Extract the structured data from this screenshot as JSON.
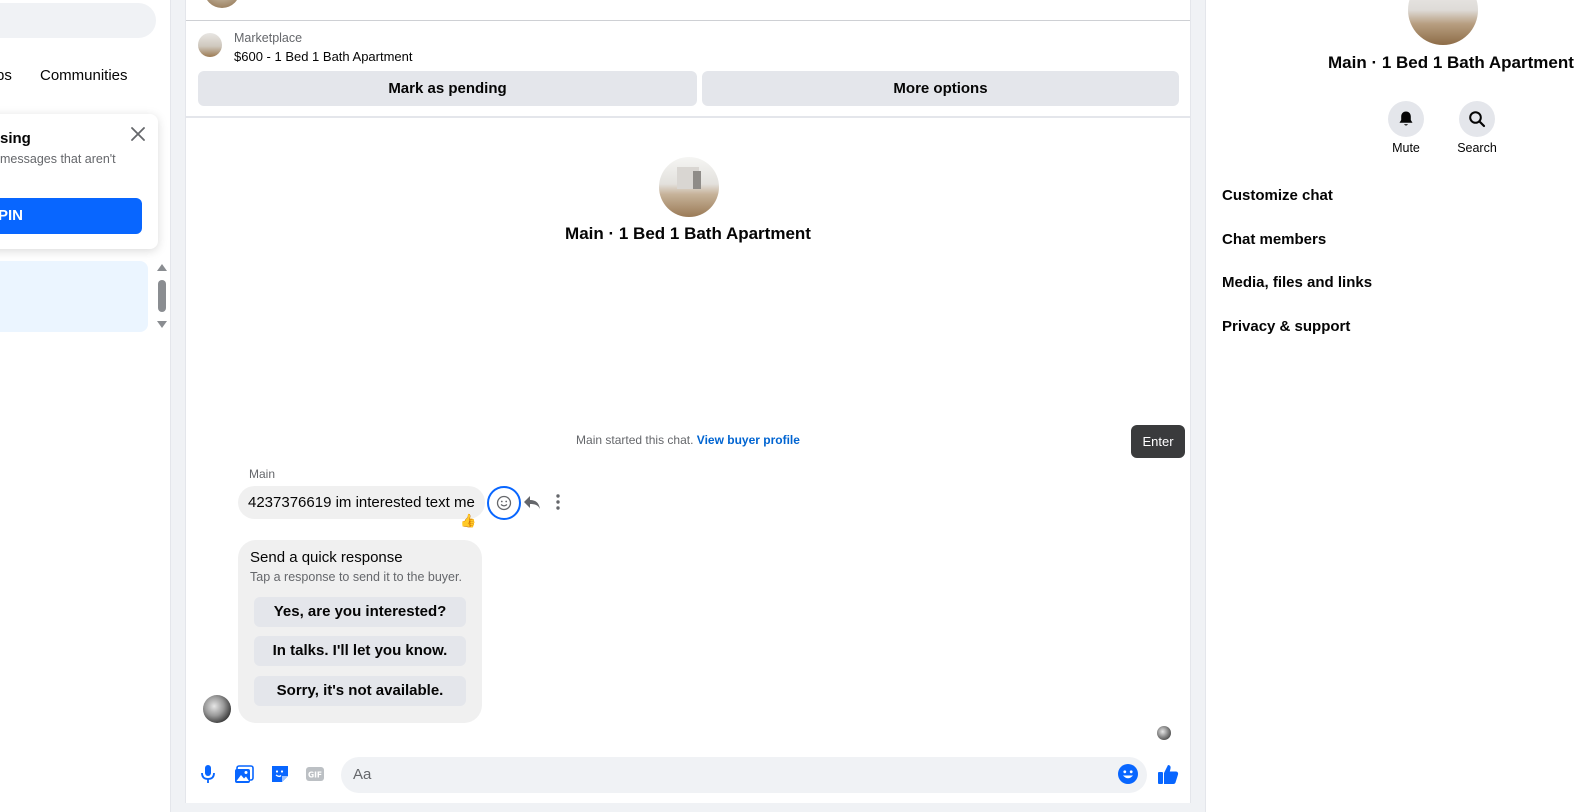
{
  "left": {
    "tab_partial": "ps",
    "tab_communities": "Communities",
    "notice": {
      "title": "sing",
      "text": "messages that aren't",
      "text2": "",
      "button": "PIN"
    }
  },
  "chat": {
    "marketplace_label": "Marketplace",
    "listing": "$600 - 1 Bed 1 Bath Apartment",
    "mark_pending": "Mark as pending",
    "more_options": "More options",
    "title": "Main · 1 Bed 1 Bath Apartment",
    "started_text": "Main started this chat.",
    "view_buyer_profile": "View buyer profile",
    "tooltip": "Enter",
    "sender": "Main",
    "message": "4237376619 im interested text me",
    "reaction": "👍",
    "quick_response": {
      "title": "Send a quick response",
      "subtitle": "Tap a response to send it to the buyer.",
      "options": [
        "Yes, are you interested?",
        "In talks. I'll let you know.",
        "Sorry, it's not available."
      ]
    },
    "composer_placeholder": "Aa",
    "accent": "#0866ff"
  },
  "right": {
    "title": "Main · 1 Bed 1 Bath Apartment",
    "mute": "Mute",
    "search": "Search",
    "menu": [
      "Customize chat",
      "Chat members",
      "Media, files and links",
      "Privacy & support"
    ]
  }
}
